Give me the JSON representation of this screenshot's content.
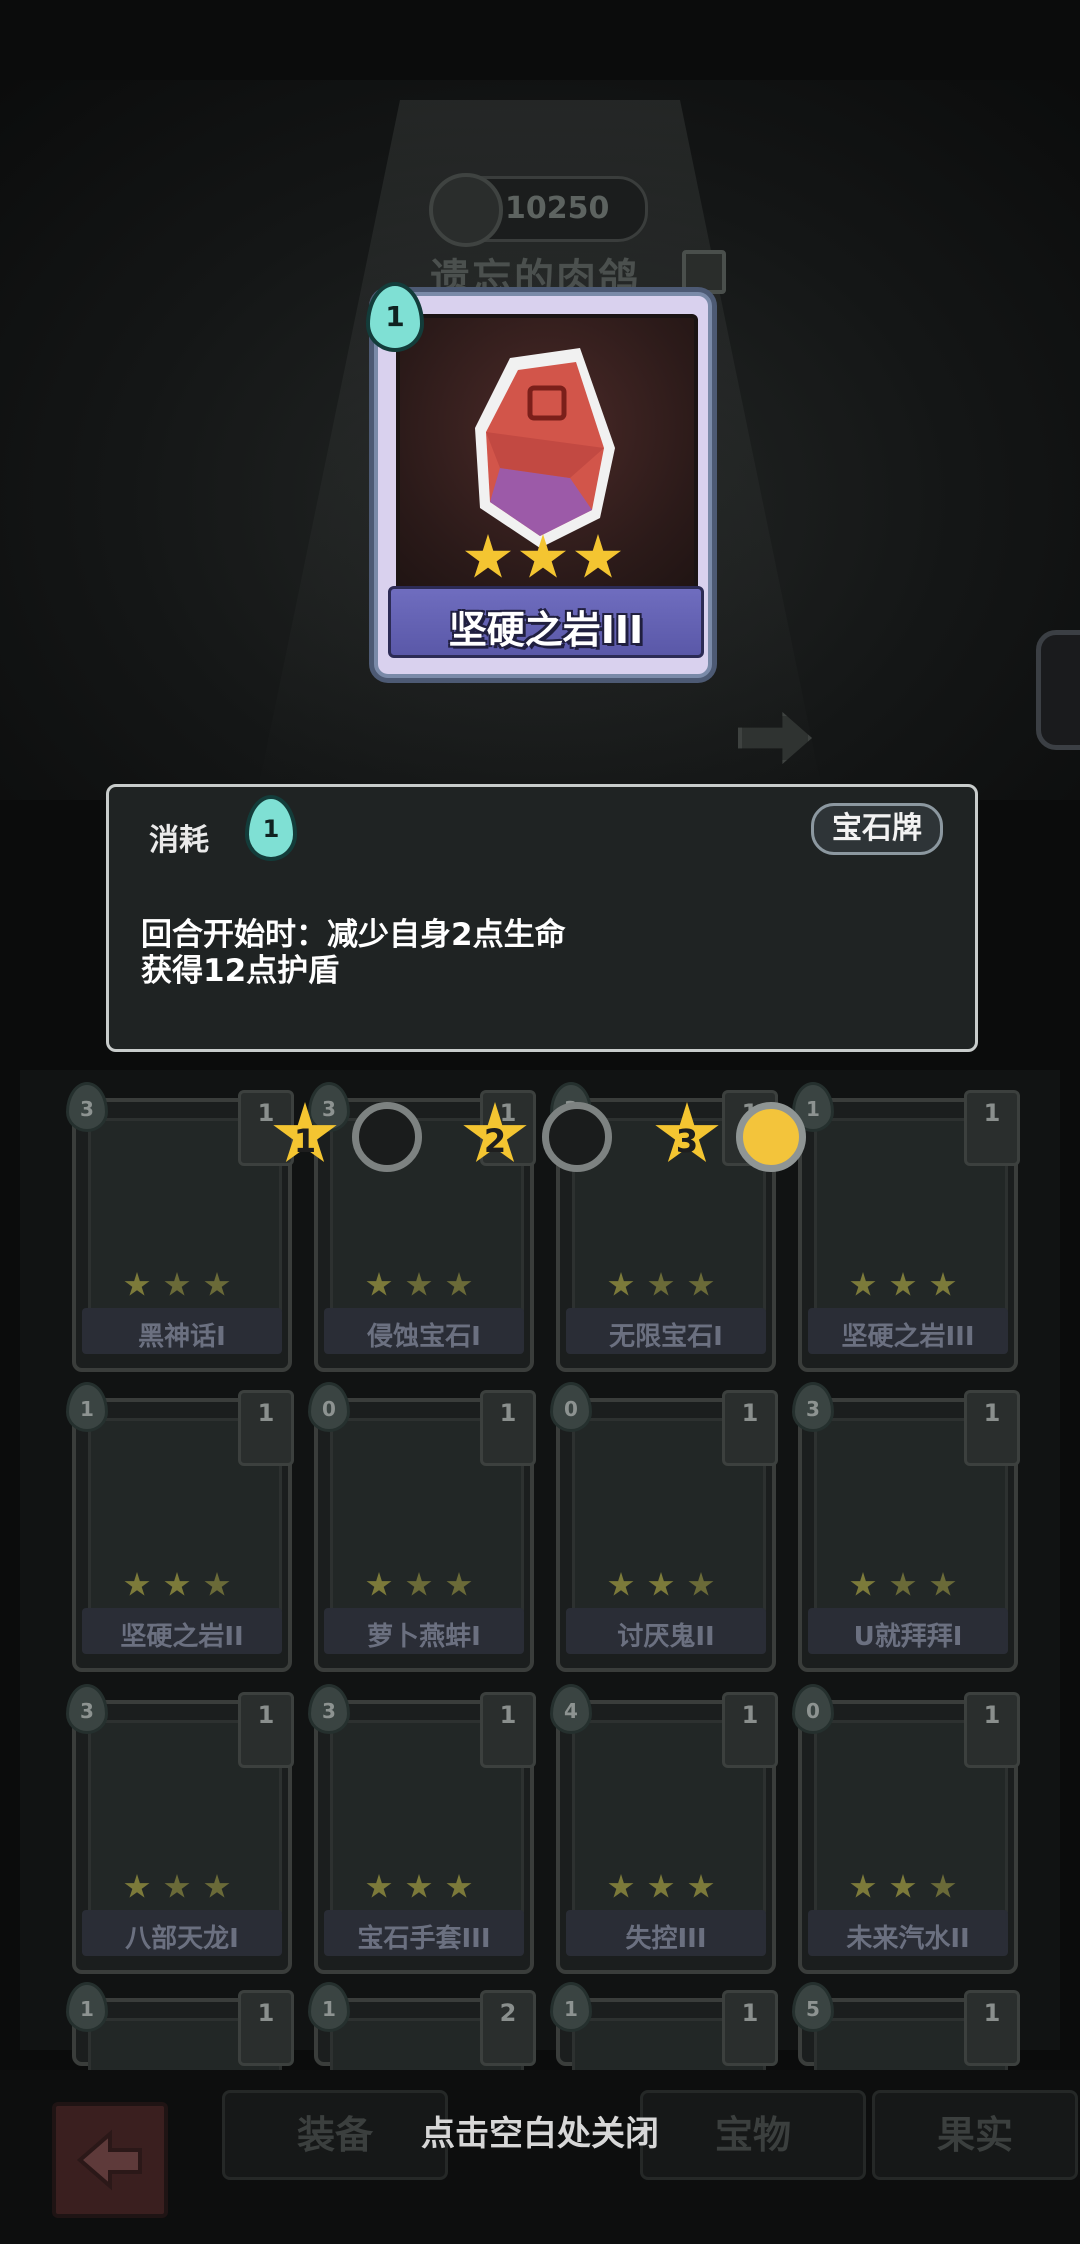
{
  "top": {
    "coins": "10250",
    "pet_name": "遗忘的肉鸽"
  },
  "selected_card": {
    "name": "坚硬之岩III",
    "cost": "1",
    "stars": 3
  },
  "tooltip": {
    "cost_label": "消耗",
    "cost_value": "1",
    "tag": "宝石牌",
    "description_line1": "回合开始时：减少自身2点生命",
    "description_line2": "获得12点护盾"
  },
  "level_selector": {
    "levels": [
      "1",
      "2",
      "3"
    ],
    "selected_level": "3"
  },
  "cards": [
    {
      "name": "黑神话I",
      "cost": "3",
      "count": "1"
    },
    {
      "name": "侵蚀宝石I",
      "cost": "3",
      "count": "1"
    },
    {
      "name": "无限宝石I",
      "cost": "3",
      "count": "1"
    },
    {
      "name": "坚硬之岩III",
      "cost": "1",
      "count": "1"
    },
    {
      "name": "坚硬之岩II",
      "cost": "1",
      "count": "1"
    },
    {
      "name": "萝卜燕蚌I",
      "cost": "0",
      "count": "1"
    },
    {
      "name": "讨厌鬼II",
      "cost": "0",
      "count": "1"
    },
    {
      "name": "U就拜拜I",
      "cost": "3",
      "count": "1"
    },
    {
      "name": "八部天龙I",
      "cost": "3",
      "count": "1"
    },
    {
      "name": "宝石手套III",
      "cost": "3",
      "count": "1"
    },
    {
      "name": "失控III",
      "cost": "4",
      "count": "1"
    },
    {
      "name": "未来汽水II",
      "cost": "0",
      "count": "1"
    },
    {
      "name": "",
      "cost": "1",
      "count": "1"
    },
    {
      "name": "",
      "cost": "1",
      "count": "2"
    },
    {
      "name": "",
      "cost": "1",
      "count": "1"
    },
    {
      "name": "",
      "cost": "5",
      "count": "1"
    }
  ],
  "bottom": {
    "tabs": [
      "装备",
      "宝物",
      "果实"
    ],
    "close_hint": "点击空白处关闭"
  },
  "colors": {
    "gold_star": "#f4c531",
    "flame": "#7fe0d4",
    "card_purple": "#6f6dbf"
  }
}
